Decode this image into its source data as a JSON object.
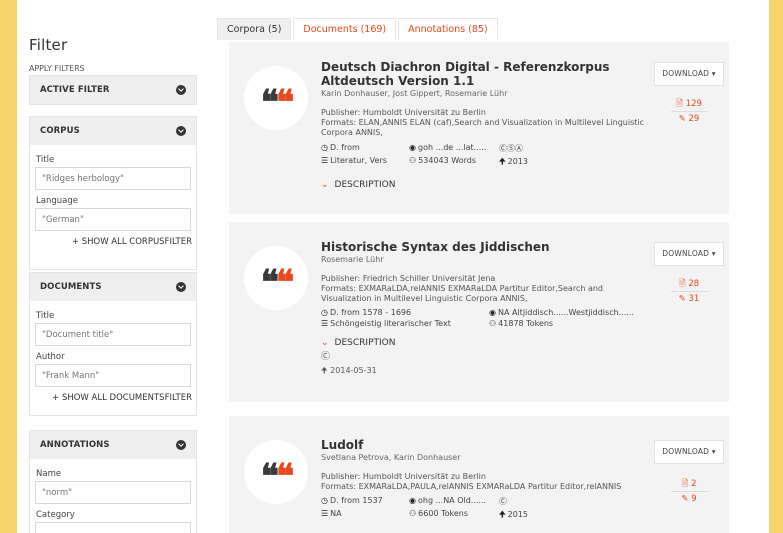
{
  "sidebar": {
    "title": "Filter",
    "apply": "APPLY FILTERS",
    "active_filter": "ACTIVE FILTER",
    "corpus": {
      "header": "CORPUS",
      "title_label": "Title",
      "title_placeholder": "\"Ridges herbology\"",
      "language_label": "Language",
      "language_placeholder": "\"German\"",
      "show_all": "+ SHOW ALL CORPUSFILTER"
    },
    "documents": {
      "header": "DOCUMENTS",
      "title_label": "Title",
      "title_placeholder": "\"Document title\"",
      "author_label": "Author",
      "author_placeholder": "\"Frank Mann\"",
      "show_all": "+ SHOW ALL DOCUMENTSFILTER"
    },
    "annotations": {
      "header": "ANNOTATIONS",
      "name_label": "Name",
      "name_placeholder": "\"norm\"",
      "category_label": "Category"
    }
  },
  "tabs": [
    {
      "label": "Corpora (5)"
    },
    {
      "label": "Documents (169)"
    },
    {
      "label": "Annotations (85)"
    }
  ],
  "download_label": "DOWNLOAD ▾",
  "description_label": "DESCRIPTION",
  "results": [
    {
      "title": "Deutsch Diachron Digital - Referenzkorpus Altdeutsch Version 1.1",
      "authors": "Karin Donhauser, Jost Gippert, Rosemarie Lühr",
      "publisher": "Publisher: Humboldt Universität zu Berlin",
      "formats": "Formats: ELAN,ANNIS ELAN (caf),Search and Visualization in Multilevel Linguistic Corpora ANNIS,",
      "date": "D. from",
      "lang": "goh ...de ...lat.....",
      "license": "ⒸⓈⒶ",
      "genre": "Literatur, Vers",
      "size": "534043 Words",
      "year": "2013",
      "doc_count": "129",
      "anno_count": "29"
    },
    {
      "title": "Historische Syntax des Jiddischen",
      "authors": "Rosemarie Lühr",
      "publisher": "Publisher: Friedrich Schiller Universität Jena",
      "formats": "Formats: EXMARaLDA,relANNIS EXMARaLDA Partitur Editor,Search and Visualization in Multilevel Linguistic Corpora ANNIS,",
      "date": "D. from 1578 - 1696",
      "lang": "NA Altjiddisch......Westjiddisch......",
      "genre": "Schöngeistig literarischer Text",
      "size": "41878 Tokens",
      "license": "Ⓒ",
      "year": "2014-05-31",
      "doc_count": "28",
      "anno_count": "31"
    },
    {
      "title": "Ludolf",
      "authors": "Svetlana Petrova, Karin Donhauser",
      "publisher": "Publisher: Humboldt Universität zu Berlin",
      "formats": "Formats: EXMARaLDA,PAULA,relANNIS EXMARaLDA Partitur Editor,relANNIS",
      "date": "D. from 1537",
      "lang": "ohg ...NA Old......",
      "license": "Ⓒ",
      "genre": "NA",
      "size": "6600 Tokens",
      "year": "2015",
      "doc_count": "2",
      "anno_count": "9"
    }
  ]
}
